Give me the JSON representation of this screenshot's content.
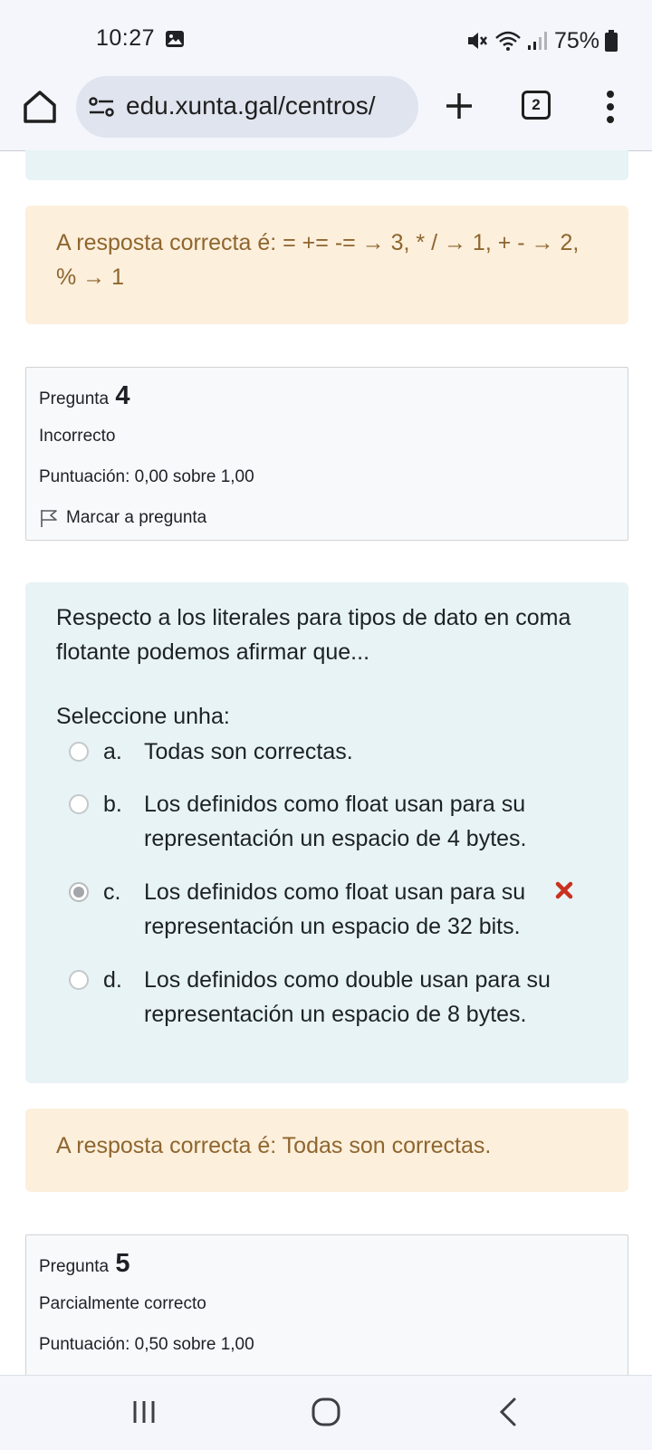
{
  "status_bar": {
    "time": "10:27",
    "battery": "75%"
  },
  "browser": {
    "url": "edu.xunta.gal/centros/",
    "tab_count": "2"
  },
  "feedback_prev": {
    "text": "A resposta correcta é: = += -= → 3, * / → 1, + - → 2, % → 1"
  },
  "question4": {
    "label": "Pregunta",
    "number": "4",
    "state": "Incorrecto",
    "grade": "Puntuación: 0,00 sobre 1,00",
    "flag_label": "Marcar a pregunta",
    "text": "Respecto a los literales para tipos de dato en coma flotante podemos afirmar que...",
    "prompt": "Seleccione unha:",
    "answers": [
      {
        "letter": "a.",
        "text": "Todas son correctas.",
        "selected": false
      },
      {
        "letter": "b.",
        "text": "Los definidos como float usan para su representación un espacio de 4 bytes.",
        "selected": false
      },
      {
        "letter": "c.",
        "text": "Los definidos como float usan para su representación un espacio de 32 bits.",
        "selected": true,
        "marked_wrong": true
      },
      {
        "letter": "d.",
        "text": "Los definidos como double usan para su representación un espacio de 8 bytes.",
        "selected": false
      }
    ],
    "feedback": "A resposta correcta é: Todas son correctas."
  },
  "question5": {
    "label": "Pregunta",
    "number": "5",
    "state": "Parcialmente correcto",
    "grade": "Puntuación: 0,50 sobre 1,00"
  },
  "colors": {
    "question_bg": "#e7f3f5",
    "feedback_bg": "#fcefdc",
    "feedback_text": "#8e662e",
    "wrong_mark": "#ca3120"
  },
  "icons": {
    "home": "home-icon",
    "site_settings": "tune-icon",
    "new_tab": "plus-icon",
    "menu": "more-vert-icon",
    "flag": "flag-icon",
    "wrong": "cross-icon"
  }
}
